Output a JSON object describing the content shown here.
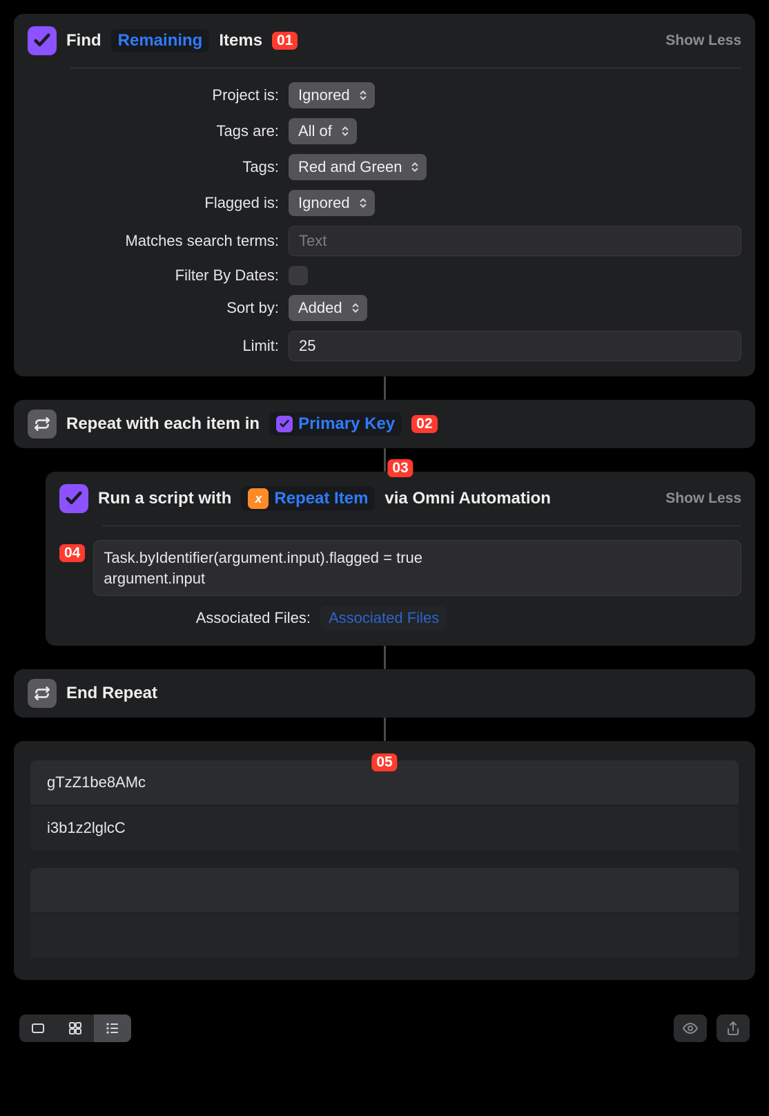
{
  "card1": {
    "title_pre": "Find",
    "token": "Remaining",
    "title_post": "Items",
    "badge": "01",
    "show_toggle": "Show Less",
    "rows": {
      "project_label": "Project is:",
      "project_value": "Ignored",
      "tagsare_label": "Tags are:",
      "tagsare_value": "All of",
      "tags_label": "Tags:",
      "tags_value": "Red and Green",
      "flagged_label": "Flagged is:",
      "flagged_value": "Ignored",
      "search_label": "Matches search terms:",
      "search_placeholder": "Text",
      "filterdates_label": "Filter By Dates:",
      "sortby_label": "Sort by:",
      "sortby_value": "Added",
      "limit_label": "Limit:",
      "limit_value": "25"
    }
  },
  "card2": {
    "title_pre": "Repeat with each item in",
    "token": "Primary Key",
    "badge": "02"
  },
  "card3": {
    "badge_top": "03",
    "title_pre": "Run a script with",
    "token": "Repeat Item",
    "title_post": "via Omni Automation",
    "show_toggle": "Show Less",
    "badge_code": "04",
    "code": "Task.byIdentifier(argument.input).flagged = true\nargument.input",
    "assoc_label": "Associated Files:",
    "assoc_token": "Associated Files"
  },
  "card4": {
    "title": "End Repeat"
  },
  "results": {
    "badge": "05",
    "rows": [
      "gTzZ1be8AMc",
      "i3b1z2lglcC",
      "",
      ""
    ]
  }
}
